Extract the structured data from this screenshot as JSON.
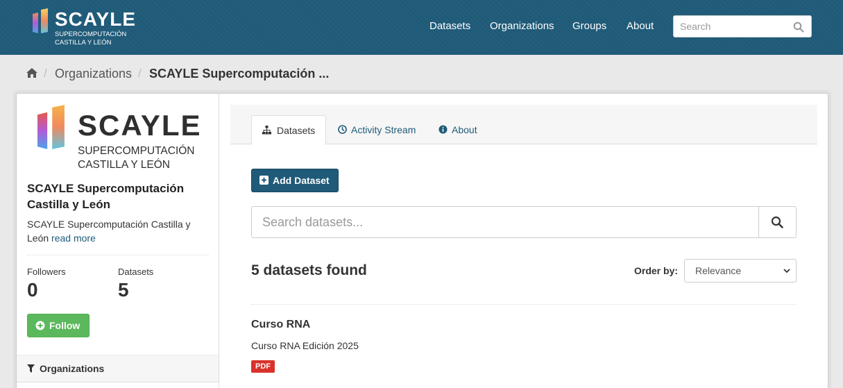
{
  "header": {
    "brand": "SCAYLE",
    "brand_sub1": "SUPERCOMPUTACIÓN",
    "brand_sub2": "CASTILLA Y LEÓN",
    "nav": [
      "Datasets",
      "Organizations",
      "Groups",
      "About"
    ],
    "search_placeholder": "Search"
  },
  "breadcrumb": {
    "separator": "/",
    "link": "Organizations",
    "active": "SCAYLE Supercomputación ..."
  },
  "sidebar": {
    "logo_brand": "SCAYLE",
    "logo_sub1": "SUPERCOMPUTACIÓN",
    "logo_sub2": "CASTILLA Y LEÓN",
    "title": "SCAYLE Supercomputación Castilla y León",
    "description": "SCAYLE Supercomputación Castilla y León",
    "read_more": "read more",
    "followers_label": "Followers",
    "followers_value": "0",
    "datasets_label": "Datasets",
    "datasets_value": "5",
    "follow_label": "Follow",
    "facet_heading": "Organizations"
  },
  "tabs": [
    {
      "label": "Datasets",
      "active": true
    },
    {
      "label": "Activity Stream",
      "active": false
    },
    {
      "label": "About",
      "active": false
    }
  ],
  "main": {
    "add_dataset_label": "Add Dataset",
    "search_placeholder": "Search datasets...",
    "found_text": "5 datasets found",
    "order_label": "Order by:",
    "order_value": "Relevance",
    "datasets": [
      {
        "title": "Curso RNA",
        "notes": "Curso RNA Edición 2025",
        "format": "PDF"
      }
    ]
  },
  "colors": {
    "masthead": "#1f5a78",
    "accent": "#1f5a78",
    "follow_green": "#5cb85c",
    "pdf_badge": "#d9322b"
  }
}
